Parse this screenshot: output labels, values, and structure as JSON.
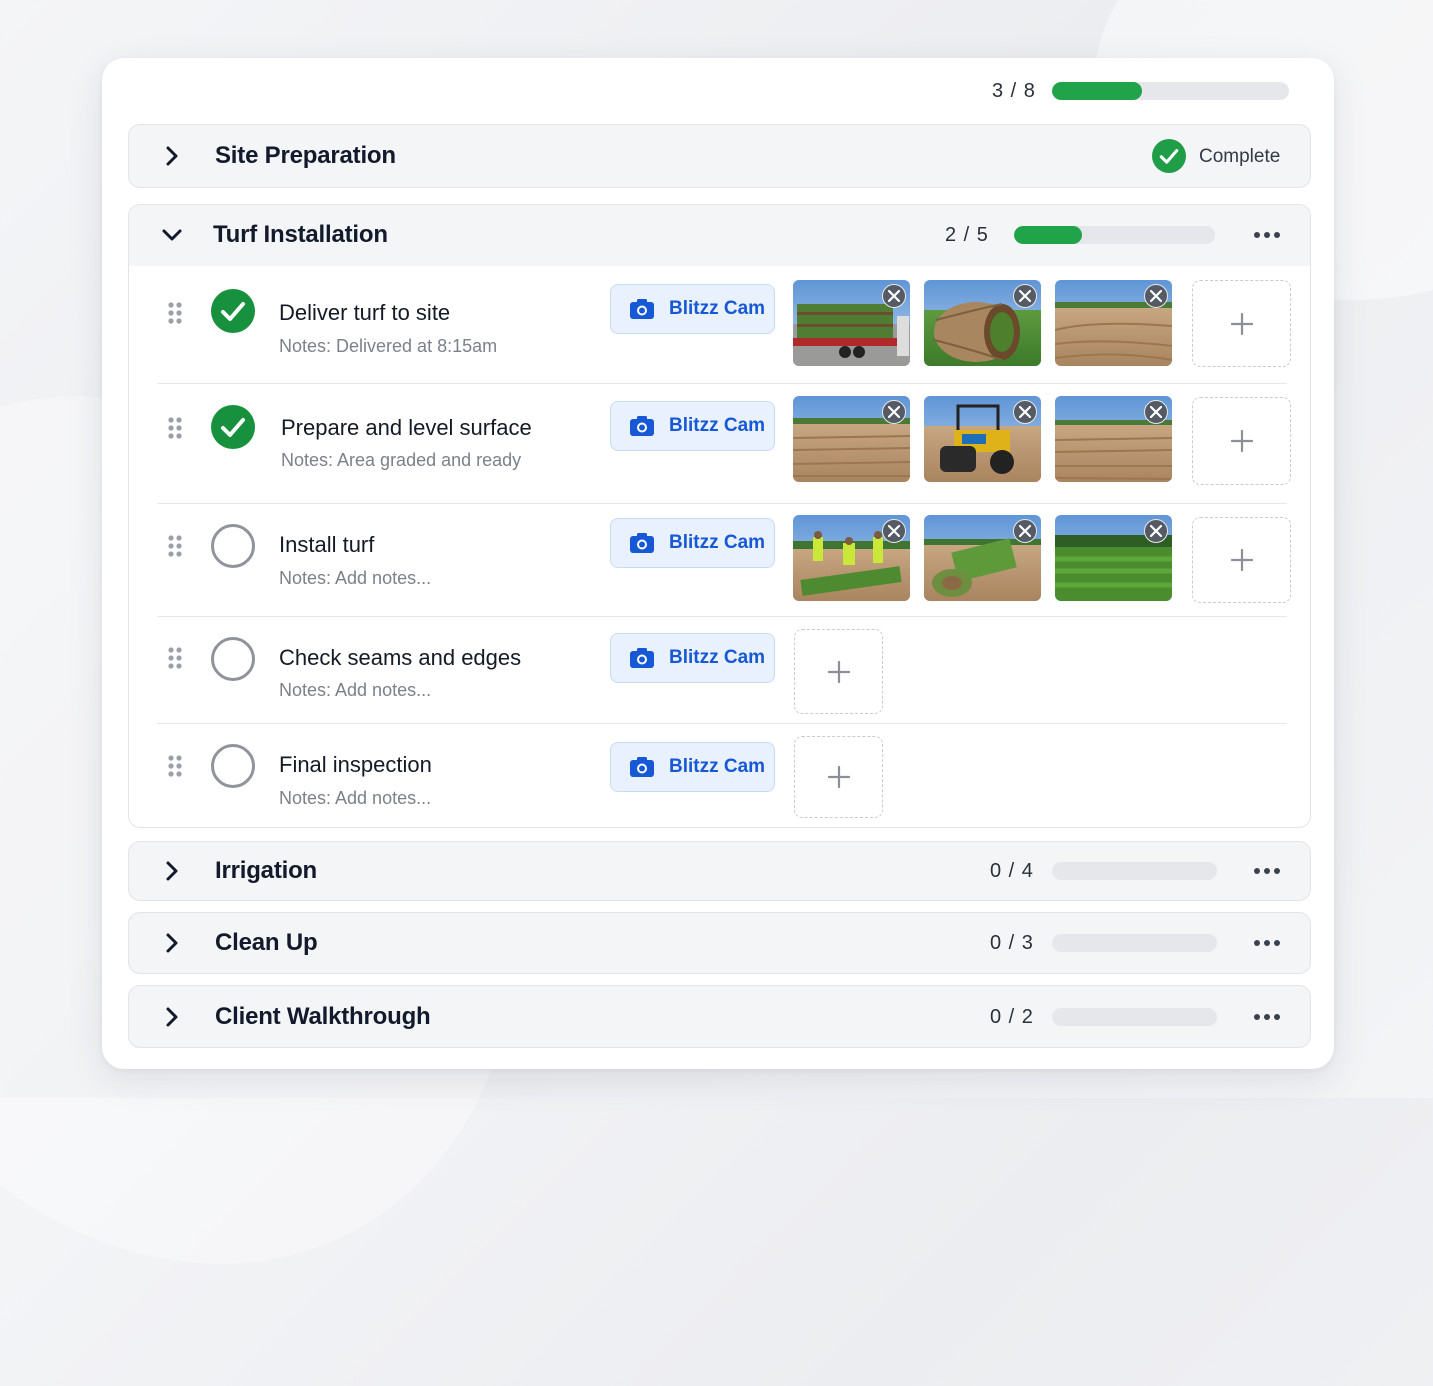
{
  "overall": {
    "count": "3 / 8",
    "progress": 0.375
  },
  "sections": {
    "site_prep": {
      "title": "Site Preparation",
      "status": "Complete"
    },
    "turf": {
      "title": "Turf Installation",
      "count": "2 / 5",
      "progress": 0.4,
      "tasks": [
        {
          "title": "Deliver turf to site",
          "notes": "Notes: Delivered at 8:15am",
          "done": true,
          "camera_label": "Blitzz Cam"
        },
        {
          "title": "Prepare and level surface",
          "notes": "Notes: Area graded and ready",
          "done": true,
          "camera_label": "Blitzz Cam"
        },
        {
          "title": "Install turf",
          "notes": "Notes: Add notes...",
          "done": false,
          "camera_label": "Blitzz Cam"
        },
        {
          "title": "Check seams and edges",
          "notes": "Notes: Add notes...",
          "done": false,
          "camera_label": "Blitzz Cam"
        },
        {
          "title": "Final inspection",
          "notes": "Notes: Add notes...",
          "done": false,
          "camera_label": "Blitzz Cam"
        }
      ]
    },
    "irrigation": {
      "title": "Irrigation",
      "count": "0 / 4",
      "progress": 0
    },
    "cleanup": {
      "title": "Clean Up",
      "count": "0 / 3",
      "progress": 0
    },
    "walkthrough": {
      "title": "Client Walkthrough",
      "count": "0 / 2",
      "progress": 0
    }
  },
  "icons": [
    "chevron-right-icon",
    "chevron-down-icon",
    "check-circle-icon",
    "more-icon",
    "drag-handle-icon",
    "camera-icon",
    "close-icon",
    "plus-icon"
  ],
  "colors": {
    "accent_green": "#21a34a",
    "camera_blue": "#1658d6",
    "check_green": "#17913d"
  }
}
